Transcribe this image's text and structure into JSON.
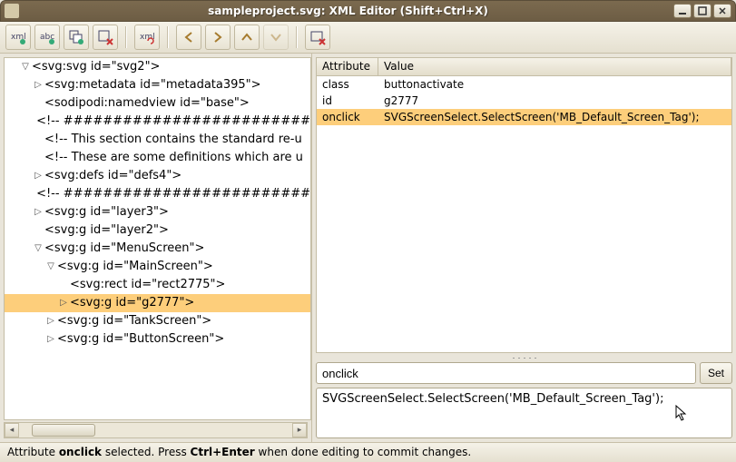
{
  "window": {
    "title": "sampleproject.svg: XML Editor (Shift+Ctrl+X)"
  },
  "toolbar": {
    "minimize": "_",
    "maximize": "□",
    "close": "×"
  },
  "tree": [
    {
      "depth": 0,
      "tw": "▽",
      "text": "<svg:svg id=\"svg2\">"
    },
    {
      "depth": 1,
      "tw": "▷",
      "text": "<svg:metadata id=\"metadata395\">"
    },
    {
      "depth": 1,
      "tw": "",
      "text": "<sodipodi:namedview id=\"base\">"
    },
    {
      "depth": 1,
      "tw": "",
      "text": "<!-- #########################"
    },
    {
      "depth": 1,
      "tw": "",
      "text": "<!-- This section contains the standard re-u"
    },
    {
      "depth": 1,
      "tw": "",
      "text": "<!-- These are some definitions which are u"
    },
    {
      "depth": 1,
      "tw": "▷",
      "text": "<svg:defs id=\"defs4\">"
    },
    {
      "depth": 1,
      "tw": "",
      "text": "<!-- #########################"
    },
    {
      "depth": 1,
      "tw": "▷",
      "text": "<svg:g id=\"layer3\">"
    },
    {
      "depth": 1,
      "tw": "",
      "text": "<svg:g id=\"layer2\">"
    },
    {
      "depth": 1,
      "tw": "▽",
      "text": "<svg:g id=\"MenuScreen\">"
    },
    {
      "depth": 2,
      "tw": "▽",
      "text": "<svg:g id=\"MainScreen\">"
    },
    {
      "depth": 3,
      "tw": "",
      "text": "<svg:rect id=\"rect2775\">"
    },
    {
      "depth": 3,
      "tw": "▷",
      "text": "<svg:g id=\"g2777\">",
      "selected": true
    },
    {
      "depth": 2,
      "tw": "▷",
      "text": "<svg:g id=\"TankScreen\">"
    },
    {
      "depth": 2,
      "tw": "▷",
      "text": "<svg:g id=\"ButtonScreen\">"
    }
  ],
  "attrs": {
    "header": {
      "a": "Attribute",
      "v": "Value"
    },
    "rows": [
      {
        "a": "class",
        "v": "buttonactivate"
      },
      {
        "a": "id",
        "v": "g2777"
      },
      {
        "a": "onclick",
        "v": "SVGScreenSelect.SelectScreen('MB_Default_Screen_Tag');",
        "selected": true
      }
    ]
  },
  "editor": {
    "attr_name": "onclick",
    "set_label": "Set",
    "attr_value": "SVGScreenSelect.SelectScreen('MB_Default_Screen_Tag');"
  },
  "status": {
    "prefix": "Attribute ",
    "attr": "onclick",
    "mid": " selected. Press ",
    "key": "Ctrl+Enter",
    "suffix": " when done editing to commit changes."
  }
}
